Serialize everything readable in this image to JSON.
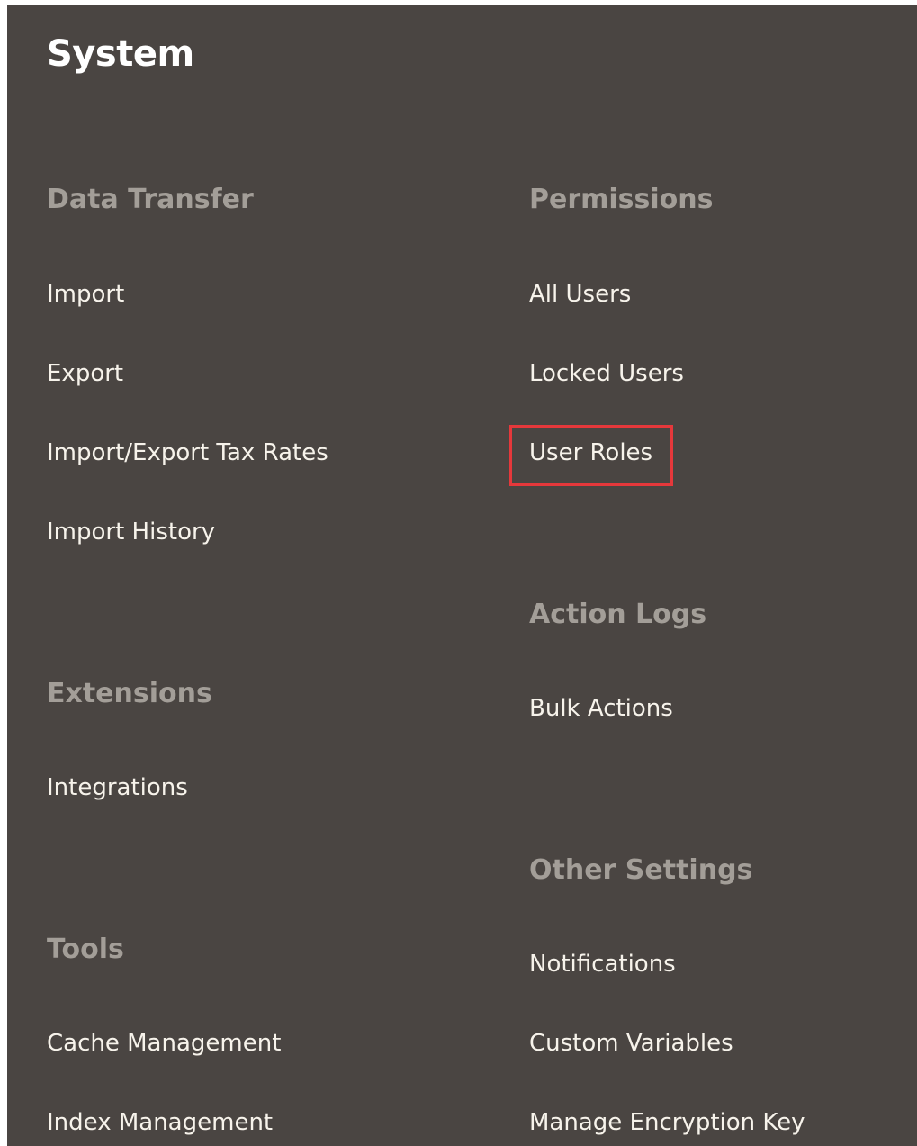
{
  "title": "System",
  "left_column": {
    "data_transfer": {
      "heading": "Data Transfer",
      "items": [
        "Import",
        "Export",
        "Import/Export Tax Rates",
        "Import History"
      ]
    },
    "extensions": {
      "heading": "Extensions",
      "items": [
        "Integrations"
      ]
    },
    "tools": {
      "heading": "Tools",
      "items": [
        "Cache Management",
        "Index Management"
      ]
    }
  },
  "right_column": {
    "permissions": {
      "heading": "Permissions",
      "items": [
        "All Users",
        "Locked Users",
        "User Roles"
      ],
      "highlighted_item": "User Roles",
      "highlight_color": "#e5383b"
    },
    "action_logs": {
      "heading": "Action Logs",
      "items": [
        "Bulk Actions"
      ]
    },
    "other_settings": {
      "heading": "Other Settings",
      "items": [
        "Notifications",
        "Custom Variables",
        "Manage Encryption Key"
      ]
    }
  },
  "colors": {
    "background": "#4a4542",
    "heading": "#a39e98",
    "link": "#f7f3eb",
    "title": "#ffffff"
  }
}
